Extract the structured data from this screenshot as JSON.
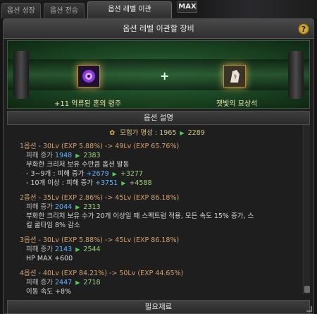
{
  "tabs": [
    {
      "label": "옵션 성장"
    },
    {
      "label": "옵션 전승"
    },
    {
      "label": "옵션 레벨 이관"
    }
  ],
  "max_badge": "MAX",
  "panel": {
    "title": "옵션 레벨 이관할 장비",
    "help_label": "?"
  },
  "banner": {
    "left_item": "+11 억류된 혼의 령주",
    "right_item": "잿빛의 묘상석",
    "plus": "+"
  },
  "description_header": "옵션 설명",
  "fame": {
    "label": "모험가 명성 :",
    "old": "1965",
    "new": "2289"
  },
  "options": [
    {
      "title": "1옵션 - 30Lv (EXP 5.88%) -> 49Lv (EXP 65.76%)",
      "damage_label": "피해 증가",
      "damage_old": "1948",
      "damage_new": "2383",
      "effect": "부화한 크리처 보유 수만큼 옵션 발동",
      "sub1_label": "- 3~9개 : 피해 증가",
      "sub1_old": "+2679",
      "sub1_new": "+3277",
      "sub2_label": "- 10개 이상 : 피해 증가",
      "sub2_old": "+3751",
      "sub2_new": "+4588"
    },
    {
      "title": "2옵션 - 35Lv (EXP 2.86%) -> 45Lv (EXP 86.18%)",
      "damage_label": "피해 증가",
      "damage_old": "2044",
      "damage_new": "2313",
      "effect_line1": "부화한 크리처 보유 수가 20개 이상일 때 스펙트럼 적용, 모든 속도 15% 증가, 스",
      "effect_line2": "킬 쿨타임 8% 감소"
    },
    {
      "title": "3옵션 - 30Lv (EXP 5.88%) -> 45Lv (EXP 86.18%)",
      "damage_label": "피해 증가",
      "damage_old": "2143",
      "damage_new": "2544",
      "effect": "HP MAX +600"
    },
    {
      "title": "4옵션 - 40Lv (EXP 84.21%) -> 50Lv (EXP 44.65%)",
      "damage_label": "피해 증가",
      "damage_old": "2447",
      "damage_new": "2718",
      "effect": "이동 속도 +8%"
    }
  ],
  "footer": "필요재료",
  "colors": {
    "banner_green": "#2f6f3a",
    "arrow_green": "#4fd05a",
    "value_blue": "#5fb4ff",
    "value_new": "#9ad37b",
    "title_orange": "#d0a070"
  }
}
